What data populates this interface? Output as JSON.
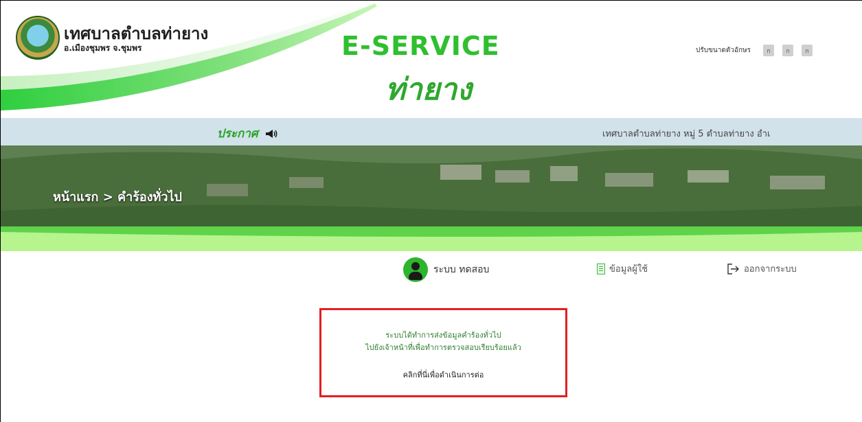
{
  "header": {
    "org_title": "เทศบาลตำบลท่ายาง",
    "org_subtitle": "อ.เมืองชุมพร จ.ชุมพร",
    "eservice_title": "E-SERVICE",
    "eservice_subtitle": "ท่ายาง",
    "font_size_label": "ปรับขนาดตัวอักษร",
    "font_size_buttons": [
      "ก",
      "ก",
      "ก"
    ]
  },
  "announce": {
    "label": "ประกาศ",
    "marquee_text": "เทศบาลตำบลท่ายาง หมู่ 5 ตำบลท่ายาง อำเ"
  },
  "banner": {
    "breadcrumb": "หน้าแรก > คำร้องทั่วไป"
  },
  "userbar": {
    "user_name": "ระบบ ทดสอบ",
    "profile_label": "ข้อมูลผู้ใช้",
    "logout_label": "ออกจากระบบ"
  },
  "message": {
    "line1": "ระบบได้ทำการส่งข้อมูลคำร้องทั่วไป",
    "line2": "ไปยังเจ้าหน้าที่เพื่อทำการตรวจสอบเรียบร้อยแล้ว",
    "continue_link": "คลิกที่นี่เพื่อดำเนินการต่อ"
  },
  "colors": {
    "brand_green": "#2fbf2f",
    "announce_bg": "#d2e2ea",
    "highlight_border": "#e41e1e"
  }
}
